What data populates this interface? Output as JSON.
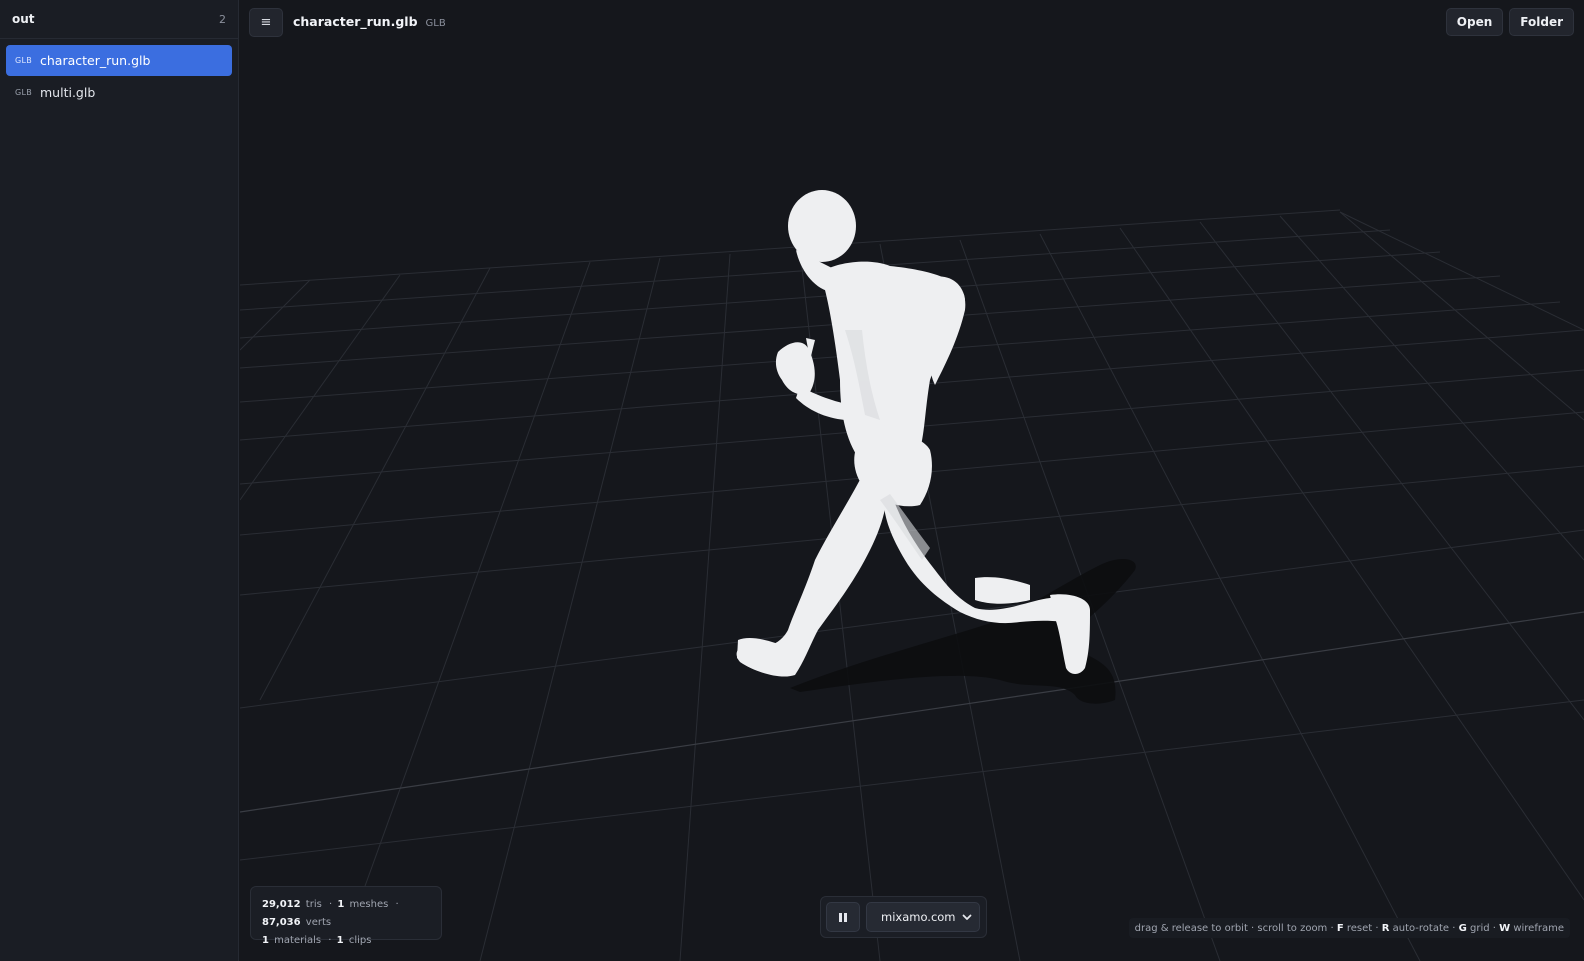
{
  "sidebar": {
    "folder": "out",
    "count": "2",
    "files": [
      {
        "type": "GLB",
        "name": "character_run.glb",
        "active": true
      },
      {
        "type": "GLB",
        "name": "multi.glb",
        "active": false
      }
    ]
  },
  "header": {
    "menu_icon": "≡",
    "title": "character_run.glb",
    "type": "GLB",
    "open_label": "Open",
    "folder_label": "Folder"
  },
  "stats": {
    "tris": "29,012",
    "tris_label": "tris",
    "meshes": "1",
    "meshes_label": "meshes",
    "verts": "87,036",
    "verts_label": "verts",
    "materials": "1",
    "materials_label": "materials",
    "clips": "1",
    "clips_label": "clips",
    "sep": "·"
  },
  "playback": {
    "clip": "mixamo.com"
  },
  "hints": {
    "orbit": "drag & release to orbit · scroll to zoom · ",
    "f_key": "F",
    "f_label": " reset · ",
    "r_key": "R",
    "r_label": " auto-rotate · ",
    "g_key": "G",
    "g_label": " grid · ",
    "w_key": "W",
    "w_label": " wireframe"
  }
}
